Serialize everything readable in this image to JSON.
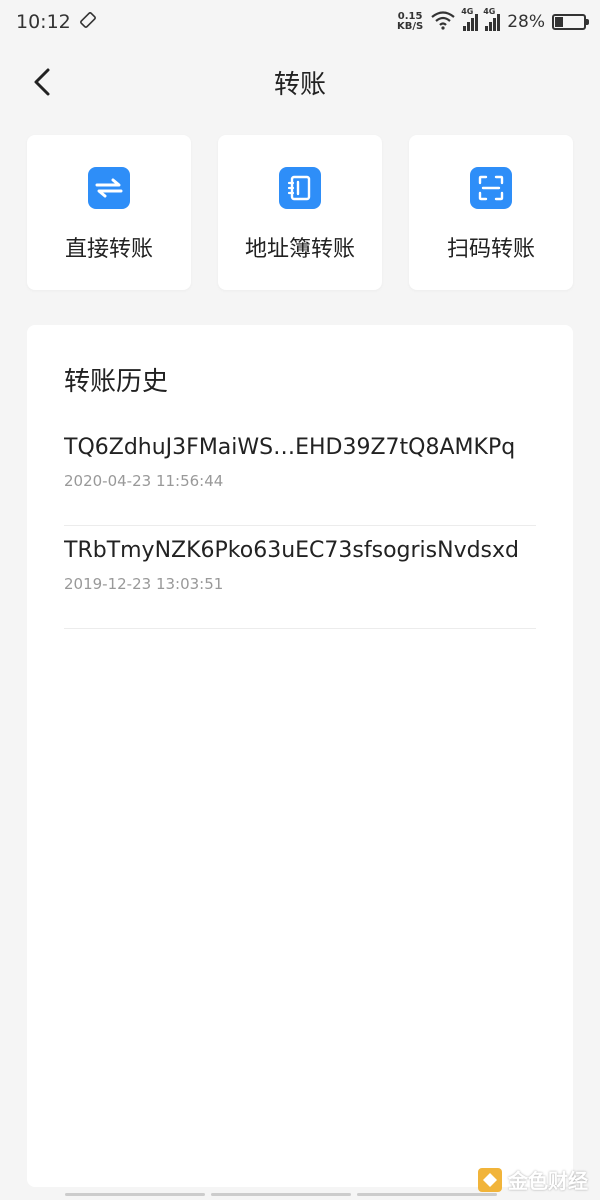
{
  "status_bar": {
    "time": "10:12",
    "net_speed_value": "0.15",
    "net_speed_unit": "KB/S",
    "signal_tag_1": "4G",
    "signal_tag_2": "4G",
    "battery_percent": "28%",
    "battery_level": 0.28
  },
  "header": {
    "title": "转账"
  },
  "actions": [
    {
      "label": "直接转账",
      "icon": "swap-arrows-icon"
    },
    {
      "label": "地址簿转账",
      "icon": "address-book-icon"
    },
    {
      "label": "扫码转账",
      "icon": "scan-icon"
    }
  ],
  "history": {
    "title": "转账历史",
    "items": [
      {
        "address": "TQ6ZdhuJ3FMaiWS…EHD39Z7tQ8AMKPq",
        "time": "2020-04-23 11:56:44"
      },
      {
        "address": "TRbTmyNZK6Pko63uEC73sfsogrisNvdsxd",
        "time": "2019-12-23 13:03:51"
      }
    ]
  },
  "watermark": {
    "text": "金色财经"
  },
  "colors": {
    "accent": "#2e8ef8",
    "background": "#f5f5f5",
    "card": "#ffffff",
    "muted_text": "#999999"
  }
}
